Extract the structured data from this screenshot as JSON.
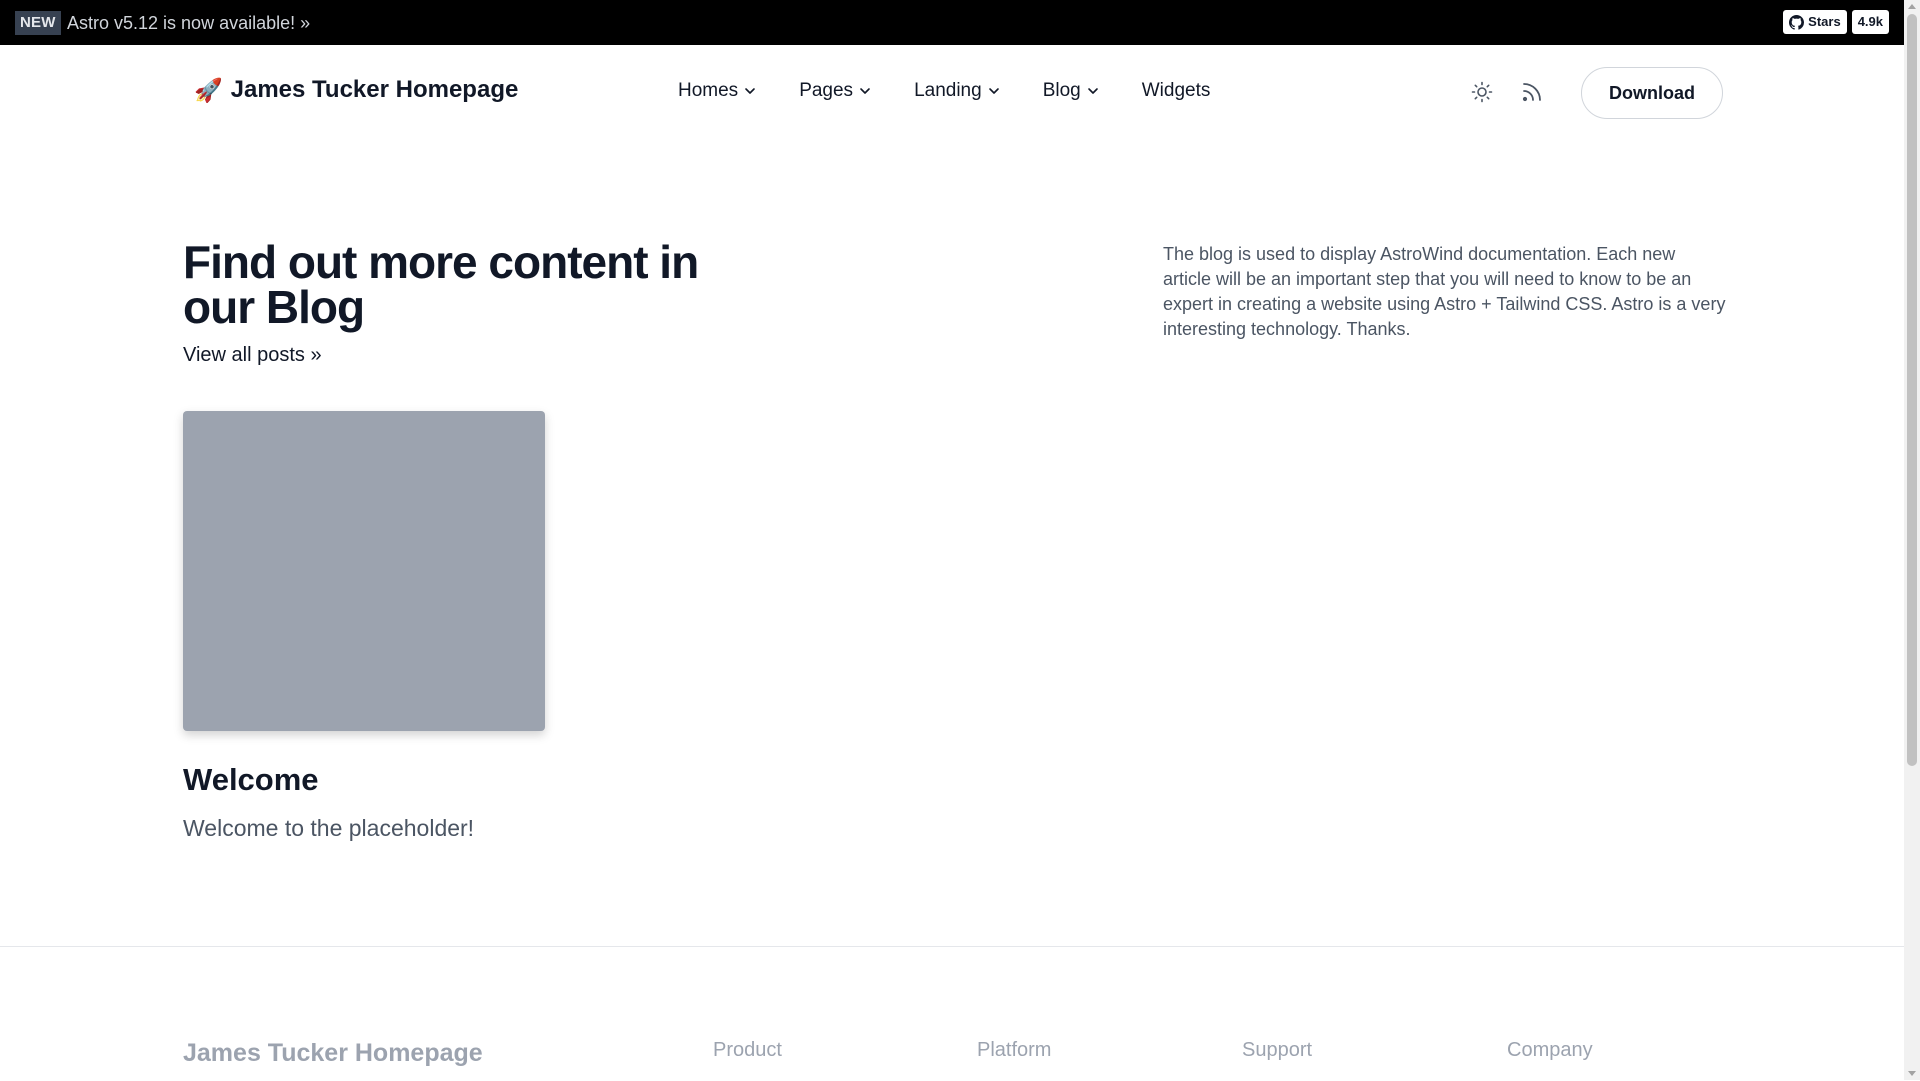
{
  "announcement": {
    "badge": "NEW",
    "message": "Astro v5.12 is now available! »"
  },
  "github": {
    "icon": "github-icon",
    "stars_label": "Stars",
    "count": "4.9k"
  },
  "header": {
    "brand": "James Tucker Homepage",
    "brand_icon": "rocket-icon",
    "nav": [
      {
        "label": "Homes",
        "has_dropdown": true
      },
      {
        "label": "Pages",
        "has_dropdown": true
      },
      {
        "label": "Landing",
        "has_dropdown": true
      },
      {
        "label": "Blog",
        "has_dropdown": true
      },
      {
        "label": "Widgets",
        "has_dropdown": false
      }
    ],
    "theme_icon": "sun-icon",
    "rss_icon": "rss-icon",
    "download_label": "Download"
  },
  "blog": {
    "title": "Find out more content in our Blog",
    "view_all": "View all posts »",
    "description": "The blog is used to display AstroWind documentation. Each new article will be an important step that you will need to know to be an expert in creating a website using Astro + Tailwind CSS. Astro is a very interesting technology. Thanks.",
    "posts": [
      {
        "title": "Welcome",
        "excerpt": "Welcome to the placeholder!"
      }
    ]
  },
  "footer": {
    "brand": "James Tucker Homepage",
    "columns": [
      "Product",
      "Platform",
      "Support",
      "Company"
    ]
  },
  "colors": {
    "announcement_bg": "#000000",
    "image_placeholder": "#9ca3af",
    "text": "#111827",
    "muted": "#4b5563"
  }
}
